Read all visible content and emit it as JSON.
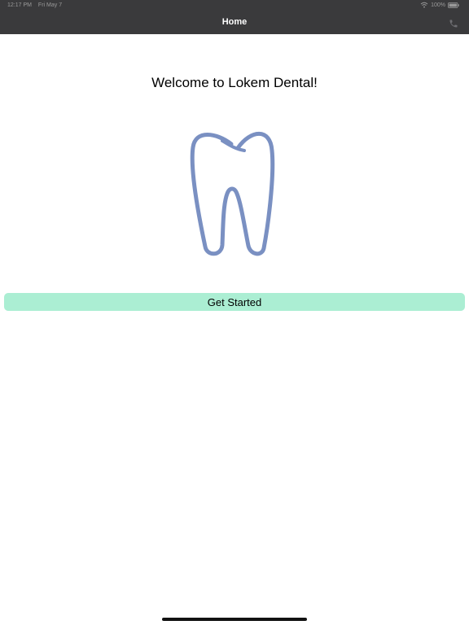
{
  "status_bar": {
    "time": "12:17 PM",
    "date": "Fri May 7",
    "battery": "100%"
  },
  "nav": {
    "title": "Home"
  },
  "main": {
    "welcome": "Welcome to Lokem Dental!",
    "cta_label": "Get Started"
  },
  "icons": {
    "status": [
      "wifi-icon",
      "battery-icon"
    ],
    "nav_right": "phone-icon",
    "logo": "tooth-logo"
  },
  "colors": {
    "nav_bar": "#3a3a3c",
    "button": "#abeed3",
    "tooth_stroke": "#7a90c2"
  }
}
